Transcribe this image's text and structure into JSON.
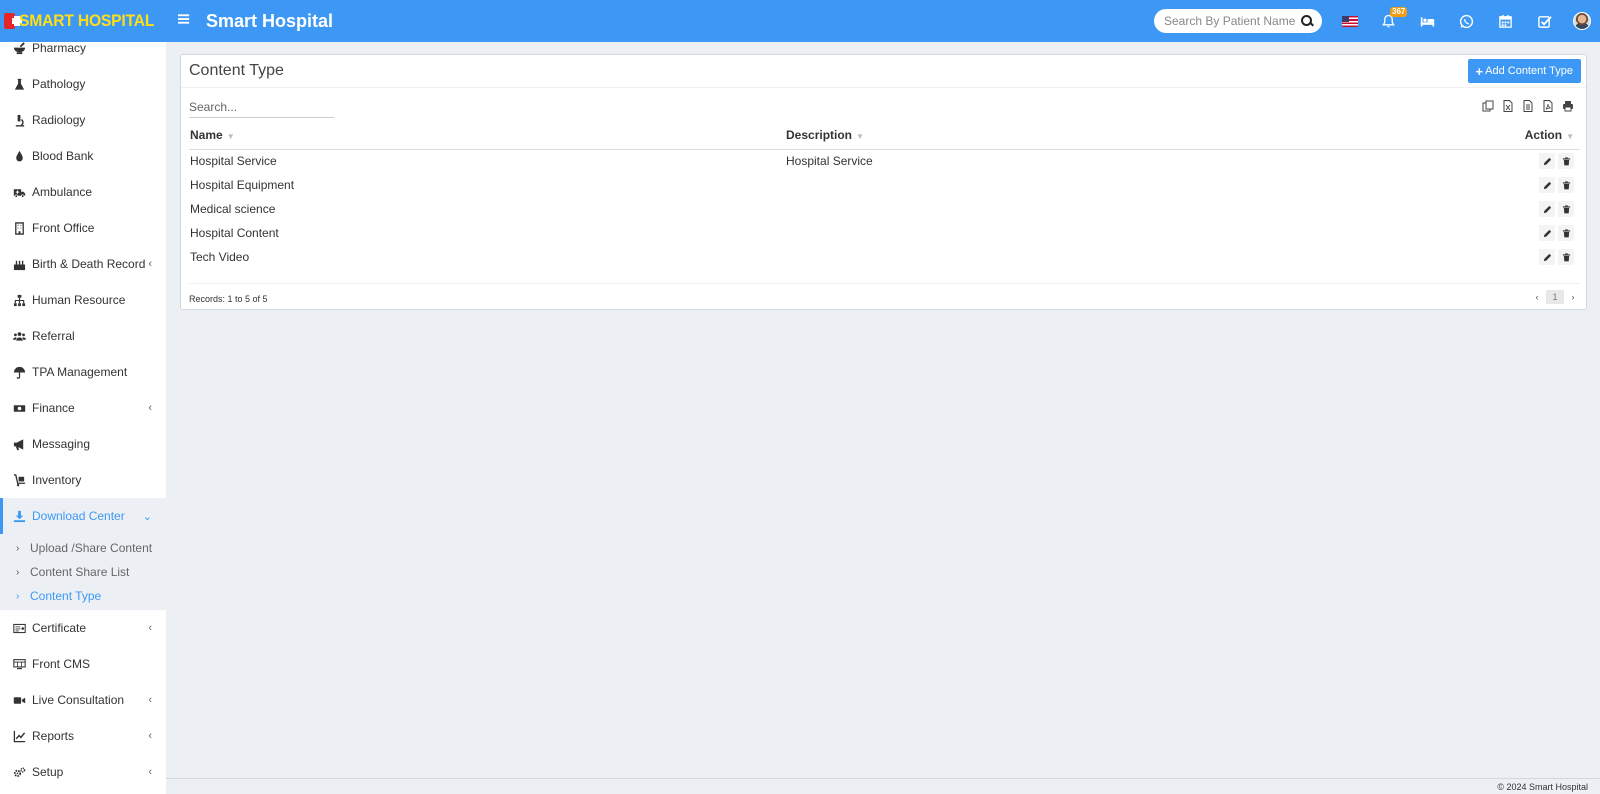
{
  "header": {
    "logo_text": "SMART HOSPITAL",
    "app_title": "Smart Hospital",
    "search_placeholder": "Search By Patient Name",
    "notification_count": "367",
    "brand_color": "#3d98f5",
    "logo_color": "#ffde17"
  },
  "sidebar": {
    "items_top": [
      {
        "label": "Pharmacy",
        "icon": "mortar-pestle-icon"
      },
      {
        "label": "Pathology",
        "icon": "flask-icon"
      },
      {
        "label": "Radiology",
        "icon": "microscope-icon"
      },
      {
        "label": "Blood Bank",
        "icon": "blood-drop-icon"
      },
      {
        "label": "Ambulance",
        "icon": "ambulance-icon"
      },
      {
        "label": "Front Office",
        "icon": "dumpster-icon"
      },
      {
        "label": "Birth & Death Record",
        "icon": "birthday-cake-icon"
      },
      {
        "label": "Human Resource",
        "icon": "sitemap-icon"
      },
      {
        "label": "Referral",
        "icon": "users-icon"
      },
      {
        "label": "TPA Management",
        "icon": "umbrella-icon"
      },
      {
        "label": "Finance",
        "icon": "money-bill-icon"
      },
      {
        "label": "Messaging",
        "icon": "bullhorn-icon"
      },
      {
        "label": "Inventory",
        "icon": "dolly-icon"
      }
    ],
    "active_item": {
      "label": "Download Center",
      "icon": "download-icon"
    },
    "submenu": [
      {
        "label": "Upload /Share Content"
      },
      {
        "label": "Content Share List"
      },
      {
        "label": "Content Type"
      }
    ],
    "items_bottom": [
      {
        "label": "Certificate",
        "icon": "certificate-icon"
      },
      {
        "label": "Front CMS",
        "icon": "cms-icon"
      },
      {
        "label": "Live Consultation",
        "icon": "video-icon"
      },
      {
        "label": "Reports",
        "icon": "line-chart-icon"
      },
      {
        "label": "Setup",
        "icon": "cogs-icon"
      }
    ]
  },
  "main": {
    "title": "Content Type",
    "add_button": "Add Content Type",
    "search_placeholder": "Search...",
    "columns": {
      "name": "Name",
      "description": "Description",
      "action": "Action"
    },
    "rows": [
      {
        "name": "Hospital Service",
        "description": "Hospital Service"
      },
      {
        "name": "Hospital Equipment",
        "description": ""
      },
      {
        "name": "Medical science",
        "description": ""
      },
      {
        "name": "Hospital Content",
        "description": ""
      },
      {
        "name": "Tech Video",
        "description": ""
      }
    ],
    "records_text": "Records: 1 to 5 of 5",
    "current_page": "1"
  },
  "footer": {
    "copyright": "© 2024 Smart Hospital"
  }
}
